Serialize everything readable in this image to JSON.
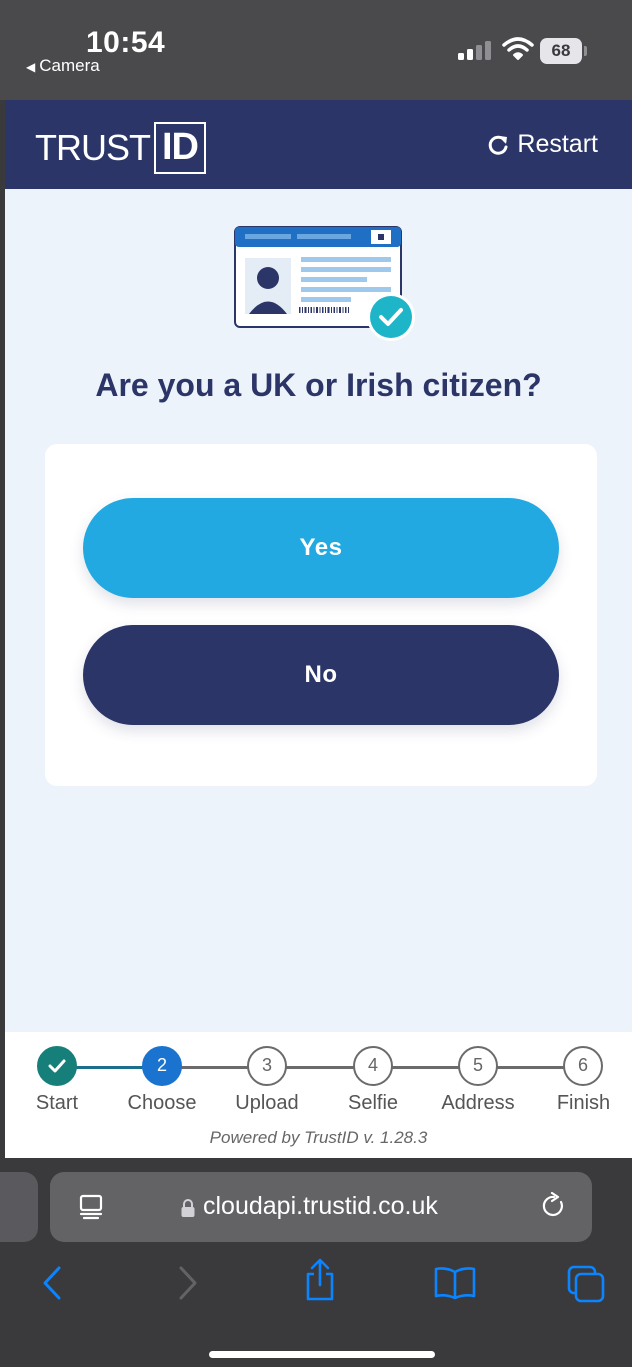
{
  "status_bar": {
    "time": "10:54",
    "back_app": "Camera",
    "battery": "68"
  },
  "header": {
    "logo_text": "TRUST",
    "logo_box_text": "ID",
    "restart_label": "Restart"
  },
  "main": {
    "question": "Are you a UK or Irish citizen?",
    "yes_label": "Yes",
    "no_label": "No"
  },
  "progress": {
    "steps": [
      {
        "number": "",
        "label": "Start",
        "state": "done"
      },
      {
        "number": "2",
        "label": "Choose",
        "state": "current"
      },
      {
        "number": "3",
        "label": "Upload",
        "state": "pending"
      },
      {
        "number": "4",
        "label": "Selfie",
        "state": "pending"
      },
      {
        "number": "5",
        "label": "Address",
        "state": "pending"
      },
      {
        "number": "6",
        "label": "Finish",
        "state": "pending"
      }
    ],
    "powered_by": "Powered by TrustID v. 1.28.3"
  },
  "browser": {
    "url": "cloudapi.trustid.co.uk"
  },
  "colors": {
    "navy": "#2c3567",
    "accent_blue": "#23a9e1",
    "page_background": "#edf3fa",
    "step_done": "#177f7a",
    "step_current": "#1a74cf",
    "safari_accent": "#0a84ff"
  },
  "icons": {
    "restart": "restart-icon",
    "id_card": "id-card-illustration",
    "check": "check-icon",
    "reader": "reader-icon",
    "lock": "lock-icon",
    "reload": "reload-icon",
    "back": "back-chevron-icon",
    "forward": "forward-chevron-icon",
    "share": "share-icon",
    "bookmarks": "bookmarks-icon",
    "tabs": "tabs-icon"
  }
}
